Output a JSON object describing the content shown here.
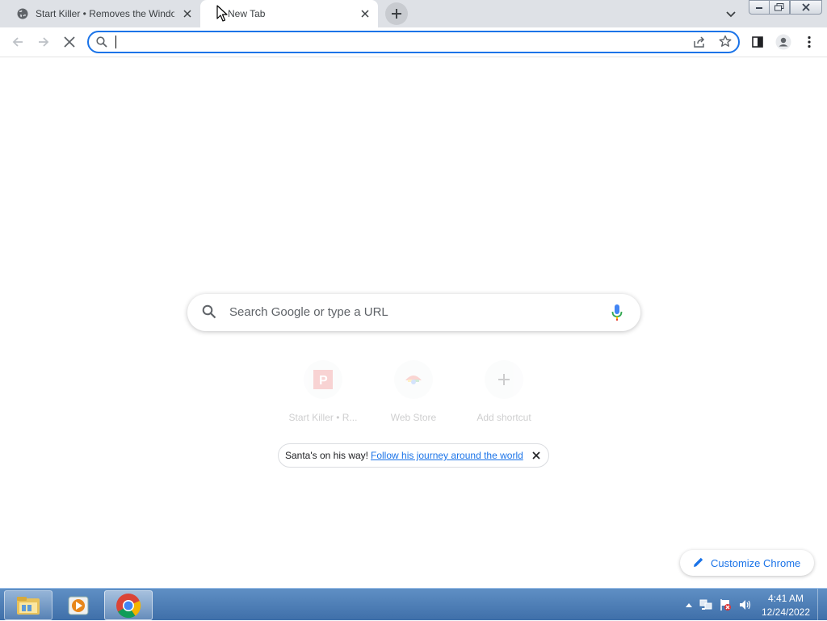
{
  "browser": {
    "tabs": [
      {
        "title": "Start Killer • Removes the Windo",
        "favicon": "globe-icon",
        "active": false
      },
      {
        "title": "New Tab",
        "favicon": "none",
        "active": true
      }
    ],
    "new_tab_icon": "plus-icon",
    "tab_search_icon": "chevron-down-icon",
    "window_controls": [
      "minimize-icon",
      "restore-icon",
      "close-icon"
    ]
  },
  "toolbar": {
    "back_icon": "arrow-left-icon",
    "forward_icon": "arrow-right-icon",
    "stop_icon": "close-icon",
    "omnibox_value": "",
    "omnibox_icons": [
      "share-icon",
      "star-icon"
    ],
    "side_panel_icon": "side-panel-icon",
    "profile_icon": "person-icon",
    "menu_icon": "kebab-icon"
  },
  "ntp": {
    "search_placeholder": "Search Google or type a URL",
    "shortcuts": [
      {
        "label": "Start Killer • R...",
        "icon": "p-icon"
      },
      {
        "label": "Web Store",
        "icon": "web-store-icon"
      },
      {
        "label": "Add shortcut",
        "icon": "plus-icon"
      }
    ],
    "promo": {
      "text": "Santa's on his way!",
      "link": "Follow his journey around the world"
    },
    "customize_label": "Customize Chrome"
  },
  "taskbar": {
    "apps": [
      "explorer-icon",
      "media-player-icon",
      "chrome-icon"
    ],
    "clock_time": "4:41 AM",
    "clock_date": "12/24/2022"
  },
  "colors": {
    "accent": "#1a73e8",
    "tabstrip": "#dee1e6",
    "taskbar": "#4a7bb5"
  }
}
